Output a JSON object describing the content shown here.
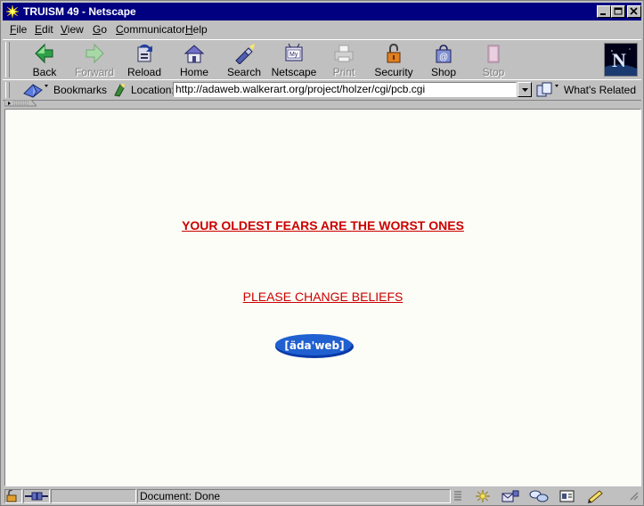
{
  "window": {
    "title": "TRUISM 49 - Netscape",
    "controls": [
      "minimize",
      "maximize",
      "close"
    ]
  },
  "menu": {
    "items": [
      {
        "u": "F",
        "rest": "ile"
      },
      {
        "u": "E",
        "rest": "dit"
      },
      {
        "u": "V",
        "rest": "iew"
      },
      {
        "u": "G",
        "rest": "o"
      },
      {
        "u": "C",
        "rest": "ommunicator"
      },
      {
        "u": "H",
        "rest": "elp"
      }
    ]
  },
  "toolbar": {
    "back": "Back",
    "forward": "Forward",
    "reload": "Reload",
    "home": "Home",
    "search": "Search",
    "netscape": "Netscape",
    "print": "Print",
    "security": "Security",
    "shop": "Shop",
    "stop": "Stop",
    "disabled": [
      "Forward",
      "Print",
      "Stop"
    ]
  },
  "location_bar": {
    "bookmarks": "Bookmarks",
    "location_label": "Location:",
    "url": "http://adaweb.walkerart.org/project/holzer/cgi/pcb.cgi",
    "whats_related": "What's Related"
  },
  "page": {
    "headline": "YOUR OLDEST FEARS ARE THE WORST ONES",
    "belief_link": "PLEASE CHANGE BELIEFS",
    "logo_text": "[äda'web]",
    "text_color": "#cc0000",
    "background": "#fcfdf6"
  },
  "status": {
    "text": "Document: Done"
  },
  "colors": {
    "titlebar": "#000080",
    "chrome": "#c0c0c0"
  }
}
